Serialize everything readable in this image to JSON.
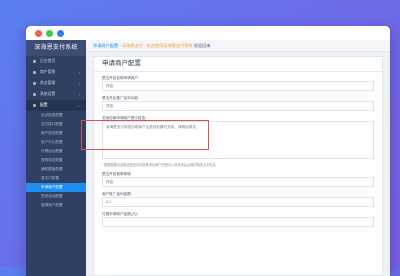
{
  "window": {
    "dots": [
      "close",
      "maximize",
      "minimize"
    ]
  },
  "sidebar": {
    "brand": "深海恩支付系统",
    "items": [
      {
        "label": "后台首页",
        "icon": "home-icon"
      },
      {
        "label": "商户管理",
        "icon": "user-icon",
        "chevron": "‹"
      },
      {
        "label": "商业管理",
        "icon": "shop-icon",
        "chevron": "‹"
      },
      {
        "label": "系统设置",
        "icon": "gear-icon",
        "chevron": "‹"
      },
      {
        "label": "配置",
        "icon": "config-icon",
        "chevron": "⌄"
      }
    ],
    "subitems": [
      "站点信息配置",
      "支付接口配置",
      "商户相关配置",
      "用户中心配置",
      "代理后台配置",
      "提现相关配置",
      "通知模板配置",
      "易支付配置",
      "申请商户配置",
      "签到活动配置",
      "邀请商户配置"
    ],
    "active_subitem_index": 8
  },
  "breadcrumb": {
    "crumb": "申请商户配置",
    "separator": " - ",
    "desc": "深海恩支付 · 欢迎使用深海恩支付系统",
    "welcome": " 欢迎回来"
  },
  "panel": {
    "title": "申请商户配置"
  },
  "form": {
    "fields": [
      {
        "label": "是否开启自助申请商户:",
        "value": "开启"
      },
      {
        "label": "是否开启推广返利功能:",
        "value": "开启"
      },
      {
        "label": "关闭自助申请商户提示信息:",
        "value": "深海恩支付系统自助商户注册目前暂时关闭，请稍后再试。"
      },
      {
        "tip": "* 根据需要对该渠道是否关闭自助申请商户的提示以及关闭后出现的相关文字信息"
      },
      {
        "label": "是否开启费率审核:",
        "value": "开启"
      },
      {
        "label": "商户推广返利金额:",
        "value": "0.1"
      },
      {
        "label": "付费申请商户金额(元):",
        "value": ""
      }
    ]
  },
  "colors": {
    "accent": "#1f8ef1",
    "sidebar_bg": "#2f4062",
    "highlight_border": "#d9534f"
  }
}
